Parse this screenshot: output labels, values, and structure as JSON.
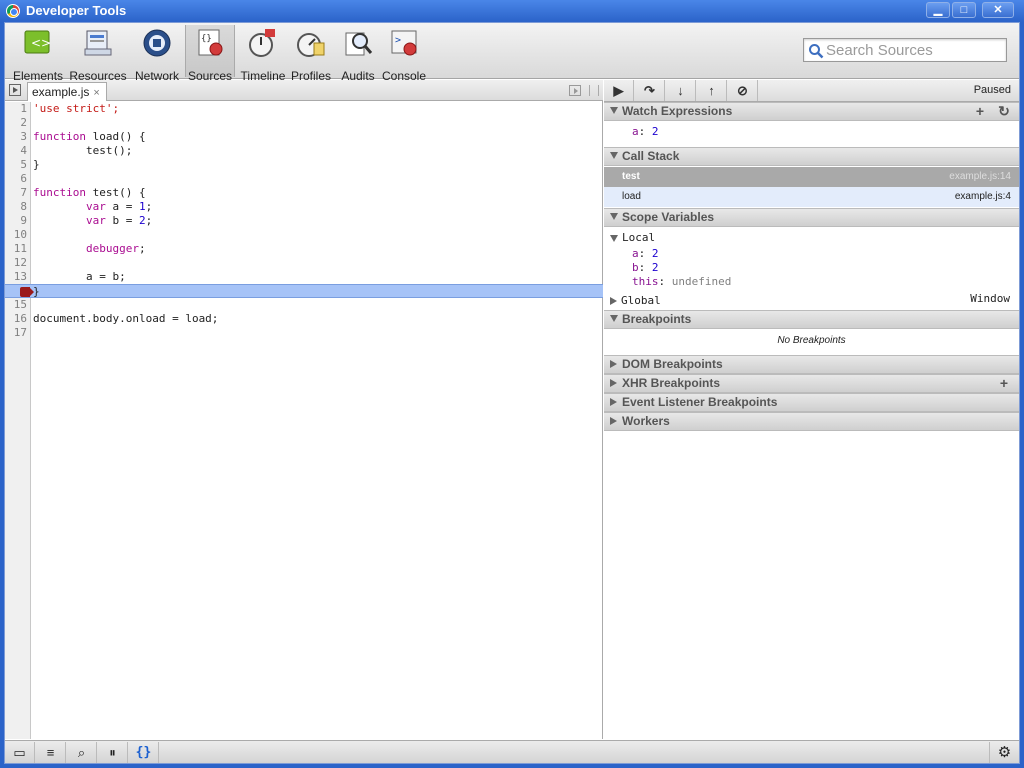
{
  "window": {
    "title": "Developer Tools",
    "min_label": "▁",
    "max_label": "□",
    "close_label": "✕"
  },
  "toolbar": {
    "panels": [
      {
        "id": "elements",
        "label": "Elements"
      },
      {
        "id": "resources",
        "label": "Resources"
      },
      {
        "id": "network",
        "label": "Network"
      },
      {
        "id": "sources",
        "label": "Sources",
        "selected": true
      },
      {
        "id": "timeline",
        "label": "Timeline"
      },
      {
        "id": "profiles",
        "label": "Profiles"
      },
      {
        "id": "audits",
        "label": "Audits"
      },
      {
        "id": "console",
        "label": "Console"
      }
    ],
    "search_placeholder": "Search Sources"
  },
  "editor": {
    "file_tab": "example.js",
    "tab_close": "×",
    "execution_line": 14,
    "lines": [
      {
        "n": "1",
        "text": "'use strict';"
      },
      {
        "n": "2",
        "text": ""
      },
      {
        "n": "3",
        "text": "function load() {"
      },
      {
        "n": "4",
        "text": "        test();"
      },
      {
        "n": "5",
        "text": "}"
      },
      {
        "n": "6",
        "text": ""
      },
      {
        "n": "7",
        "text": "function test() {"
      },
      {
        "n": "8",
        "text": "        var a = 1;"
      },
      {
        "n": "9",
        "text": "        var b = 2;"
      },
      {
        "n": "10",
        "text": ""
      },
      {
        "n": "11",
        "text": "        debugger;"
      },
      {
        "n": "12",
        "text": ""
      },
      {
        "n": "13",
        "text": "        a = b;"
      },
      {
        "n": "14",
        "text": "}"
      },
      {
        "n": "15",
        "text": ""
      },
      {
        "n": "16",
        "text": "document.body.onload = load;"
      },
      {
        "n": "17",
        "text": ""
      }
    ]
  },
  "debugger": {
    "status": "Paused",
    "buttons": [
      {
        "id": "pause-resume",
        "glyph": "▶"
      },
      {
        "id": "step-over",
        "glyph": "↷"
      },
      {
        "id": "step-into",
        "glyph": "↓"
      },
      {
        "id": "step-out",
        "glyph": "↑"
      },
      {
        "id": "deactivate-breakpoints",
        "glyph": "⊘"
      }
    ],
    "watch": {
      "title": "Watch Expressions",
      "add_glyph": "+",
      "refresh_glyph": "↻",
      "items": [
        {
          "name": "a",
          "value": "2"
        }
      ]
    },
    "call_stack": {
      "title": "Call Stack",
      "frames": [
        {
          "fn": "test",
          "loc": "example.js:14"
        },
        {
          "fn": "load",
          "loc": "example.js:4"
        }
      ]
    },
    "scope": {
      "title": "Scope Variables",
      "local_label": "Local",
      "local_vars": [
        {
          "name": "a",
          "value": "2",
          "kind": "num"
        },
        {
          "name": "b",
          "value": "2",
          "kind": "num"
        },
        {
          "name": "this",
          "value": "undefined",
          "kind": "undef"
        }
      ],
      "global_label": "Global",
      "global_value": "Window"
    },
    "breakpoints": {
      "title": "Breakpoints",
      "empty_text": "No Breakpoints"
    },
    "dom_breakpoints": {
      "title": "DOM Breakpoints"
    },
    "xhr_breakpoints": {
      "title": "XHR Breakpoints",
      "add_glyph": "+"
    },
    "event_breakpoints": {
      "title": "Event Listener Breakpoints"
    },
    "workers": {
      "title": "Workers"
    }
  },
  "statusbar": {
    "buttons": [
      {
        "id": "dock",
        "glyph": "▭"
      },
      {
        "id": "console-drawer",
        "glyph": "≡"
      },
      {
        "id": "search",
        "glyph": "⌕"
      },
      {
        "id": "pause-exceptions",
        "glyph": "⏸"
      },
      {
        "id": "pretty-print",
        "glyph": "{}"
      }
    ],
    "settings_glyph": "⚙"
  }
}
